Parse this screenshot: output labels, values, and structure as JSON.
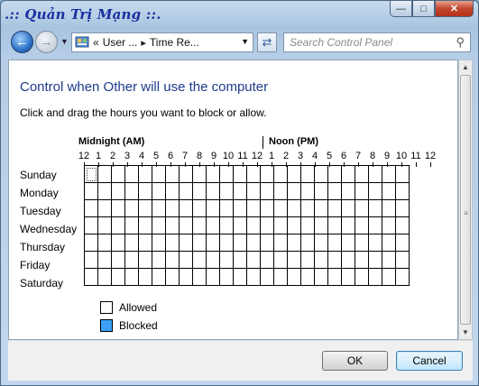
{
  "titlebar": {
    "watermark": ".:: Quản Trị Mạng ::."
  },
  "nav": {
    "breadcrumb": [
      "User ...",
      "Time Re..."
    ],
    "breadcrumb_prefix": "«",
    "search_placeholder": "Search Control Panel"
  },
  "main": {
    "heading": "Control when Other will use the computer",
    "instruction": "Click and drag the hours you want to block or allow.",
    "am_label": "Midnight (AM)",
    "pm_label": "Noon (PM)",
    "hours": [
      "12",
      "1",
      "2",
      "3",
      "4",
      "5",
      "6",
      "7",
      "8",
      "9",
      "10",
      "11",
      "12",
      "1",
      "2",
      "3",
      "4",
      "5",
      "6",
      "7",
      "8",
      "9",
      "10",
      "11",
      "12"
    ],
    "days": [
      "Sunday",
      "Monday",
      "Tuesday",
      "Wednesday",
      "Thursday",
      "Friday",
      "Saturday"
    ],
    "blocked_hours": []
  },
  "legend": {
    "allowed": "Allowed",
    "blocked": "Blocked",
    "allowed_color": "#ffffff",
    "blocked_color": "#3aa0f5"
  },
  "buttons": {
    "ok": "OK",
    "cancel": "Cancel"
  }
}
